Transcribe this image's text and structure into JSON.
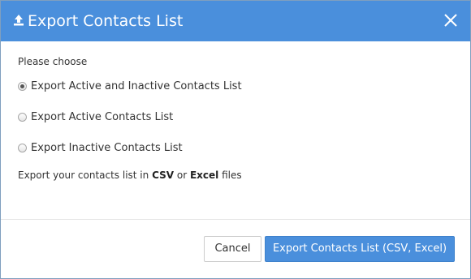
{
  "dialog": {
    "title": "Export Contacts List",
    "header_icon": "upload-icon",
    "close_icon": "close-icon"
  },
  "body": {
    "prompt": "Please choose",
    "options": [
      {
        "label": "Export Active and Inactive Contacts List",
        "checked": true
      },
      {
        "label": "Export Active Contacts List",
        "checked": false
      },
      {
        "label": "Export Inactive Contacts List",
        "checked": false
      }
    ],
    "note": {
      "prefix": "Export your contacts list in ",
      "format1": "CSV",
      "middle": " or ",
      "format2": "Excel",
      "suffix": " files"
    }
  },
  "footer": {
    "cancel_label": "Cancel",
    "export_label": "Export Contacts List (CSV, Excel)"
  },
  "colors": {
    "header": "#4a8fdc",
    "primary_button": "#4a8fdc"
  }
}
